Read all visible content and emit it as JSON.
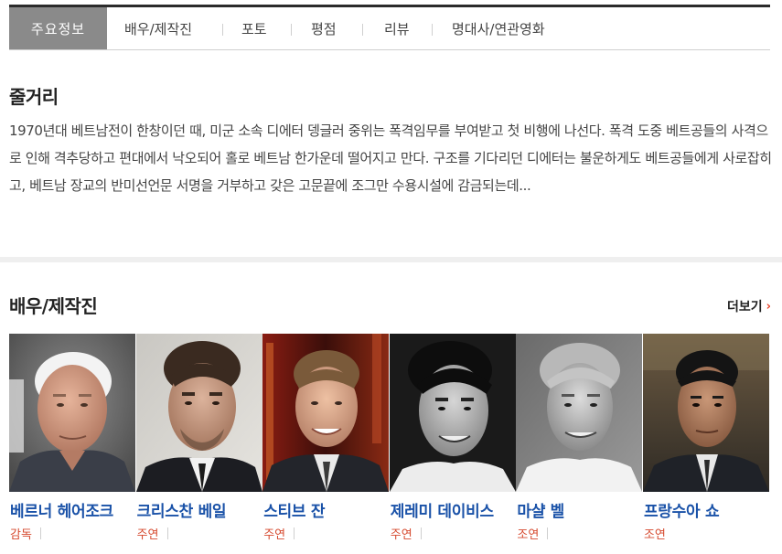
{
  "tabs": [
    {
      "label": "주요정보",
      "active": true
    },
    {
      "label": "배우/제작진",
      "active": false
    },
    {
      "label": "포토",
      "active": false
    },
    {
      "label": "평점",
      "active": false
    },
    {
      "label": "리뷰",
      "active": false
    },
    {
      "label": "명대사/연관영화",
      "active": false
    }
  ],
  "synopsis": {
    "title": "줄거리",
    "text": "1970년대 베트남전이 한창이던 때, 미군 소속 디에터 뎅글러 중위는 폭격임무를 부여받고 첫 비행에 나선다. 폭격 도중 베트공들의 사격으로 인해 격추당하고 편대에서 낙오되어 홀로 베트남 한가운데 떨어지고 만다. 구조를 기다리던 디에터는 불운하게도 베트공들에게 사로잡히고, 베트남 장교의 반미선언문 서명을 거부하고 갖은 고문끝에 조그만 수용시설에 감금되는데..."
  },
  "cast_section": {
    "title": "배우/제작진",
    "more_label": "더보기",
    "members": [
      {
        "name": "베르너 헤어조크",
        "role": "감독"
      },
      {
        "name": "크리스찬 베일",
        "role": "주연"
      },
      {
        "name": "스티브 잔",
        "role": "주연"
      },
      {
        "name": "제레미 데이비스",
        "role": "주연"
      },
      {
        "name": "마샬 벨",
        "role": "조연"
      },
      {
        "name": "프랑수아 쇼",
        "role": "조연"
      }
    ]
  },
  "colors": {
    "name_link": "#1a52a8",
    "role": "#d64a2f",
    "active_tab": "#8a8a8a",
    "accent": "#e8452c"
  }
}
